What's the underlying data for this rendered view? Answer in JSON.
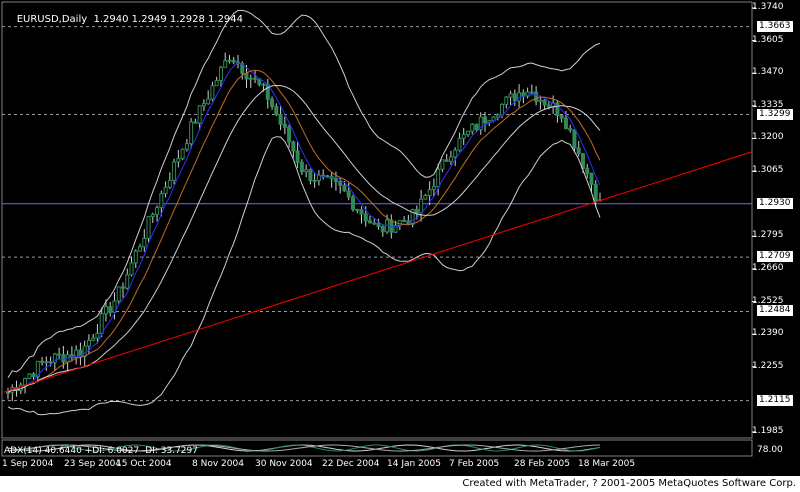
{
  "header": {
    "symbol": "EURUSD,Daily",
    "ohlc": "1.2940 1.2949 1.2928 1.2944"
  },
  "price_axis": {
    "ticks": [
      "1.3740",
      "1.3605",
      "1.3470",
      "1.3335",
      "1.3200",
      "1.3065",
      "1.2795",
      "1.2660",
      "1.2525",
      "1.2390",
      "1.2255",
      "1.1985"
    ],
    "boxed_levels": [
      "1.3663",
      "1.3299",
      "1.2930",
      "1.2709",
      "1.2484",
      "1.2115"
    ]
  },
  "indicator": {
    "label": "ADX(14) 40.6440 +DI: 6.0027 -DI: 33.7297",
    "axis_value": "78.00"
  },
  "date_axis": [
    "1 Sep 2004",
    "23 Sep 2004",
    "15 Oct 2004",
    "8 Nov 2004",
    "30 Nov 2004",
    "22 Dec 2004",
    "14 Jan 2005",
    "7 Feb 2005",
    "28 Feb 2005",
    "18 Mar 2005"
  ],
  "footer": "Created with MetaTrader, ? 2001-2005 MetaQuotes Software Corp.",
  "colors": {
    "background": "#000000",
    "trendline": "#ff0000",
    "current_price_line": "#6a6aff",
    "ma_fast": "#2f2fff",
    "ma_slow": "#c06a2a",
    "ma_mid": "#d0d0d0",
    "bollinger": "#d0d0d0",
    "candle": "#2e8b57"
  },
  "chart_data": {
    "type": "line",
    "title": "EURUSD,Daily",
    "xlabel": "",
    "ylabel": "",
    "ylim": [
      1.1985,
      1.374
    ],
    "x": [
      "1 Sep 2004",
      "23 Sep 2004",
      "15 Oct 2004",
      "8 Nov 2004",
      "30 Nov 2004",
      "22 Dec 2004",
      "14 Jan 2005",
      "7 Feb 2005",
      "28 Feb 2005",
      "18 Mar 2005"
    ],
    "series": [
      {
        "values": [
          1.215,
          1.228,
          1.232,
          1.256,
          1.292,
          1.326,
          1.355,
          1.338,
          1.306,
          1.299,
          1.282,
          1.288,
          1.316,
          1.33,
          1.341,
          1.33,
          1.293
        ]
      }
    ],
    "horizontal_levels": [
      1.3663,
      1.3299,
      1.293,
      1.2709,
      1.2484,
      1.2115
    ]
  }
}
